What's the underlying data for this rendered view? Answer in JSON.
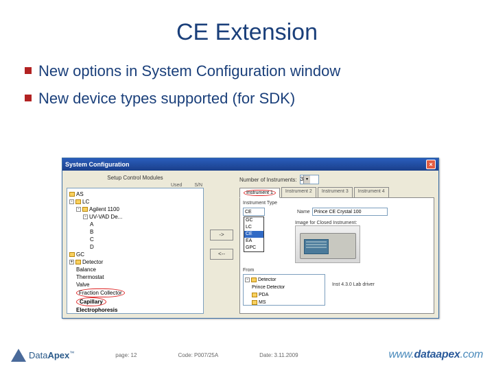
{
  "title": "CE Extension",
  "bullets": [
    "New options in System Configuration window",
    "New device types supported (for SDK)"
  ],
  "window": {
    "title": "System Configuration",
    "left_label": "Setup Control Modules",
    "hdr_used": "Used",
    "hdr_sn": "S/N",
    "tree": {
      "as": "AS",
      "lc": "LC",
      "agilent": "Agilent 1100",
      "detector_parent": "UV-VAD De...",
      "ch_a": "A",
      "ch_b": "B",
      "ch_c": "C",
      "ch_d": "D",
      "gc": "GC",
      "detector": "Detector",
      "balance": "Balance",
      "thermostat": "Thermostat",
      "valve": "Valve",
      "fraction": "Fraction Collector",
      "capillary": "Capillary",
      "electrophoresis": "Electrophoresis"
    },
    "arrow_right": "->",
    "arrow_left": "<--",
    "right": {
      "instr_count_label": "Number of Instruments:",
      "instr_count": "3",
      "tabs": [
        "Instrument 1",
        "Instrument 2",
        "Instrument 3",
        "Instrument 4"
      ],
      "type_label": "Instrument Type",
      "type_value": "CE",
      "type_options": [
        "GC",
        "LC",
        "CE",
        "EA",
        "GPC"
      ],
      "name_label": "Name",
      "name_value": "Prince CE Crystal 100",
      "image_hint": "Image for Closed Instrument:",
      "from_label": "From",
      "subtree": {
        "detector": "Detector",
        "prince": "Prince Detector",
        "pda": "PDA",
        "ms": "MS"
      },
      "driver_label": "Inst 4.3.0 Lab driver"
    }
  },
  "footer": {
    "logo_text_1": "Data",
    "logo_text_2": "Apex",
    "page_label": "page:",
    "page_value": "12",
    "code_label": "Code:",
    "code_value": "P007/25A",
    "date_label": "Date:",
    "date_value": "3.11.2009",
    "url_prefix": "www.",
    "url_main": "dataapex",
    "url_suffix": ".com"
  }
}
